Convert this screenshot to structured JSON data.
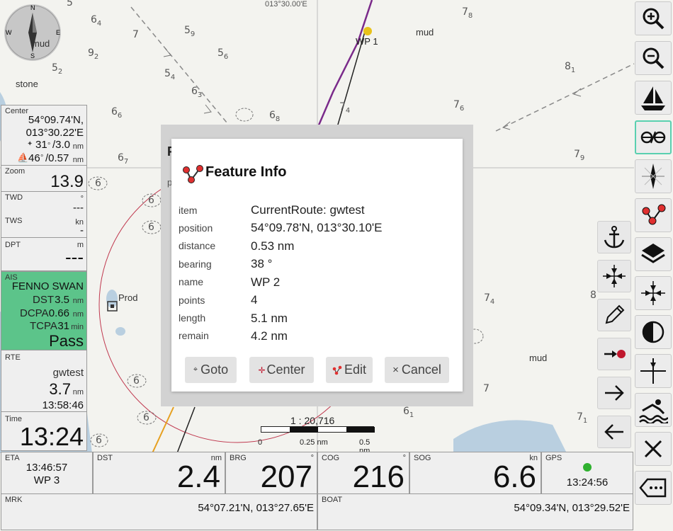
{
  "map": {
    "top_coordinate": "013°30.00'E",
    "labels": {
      "mud1": "mud",
      "mud2": "mud",
      "mud3": "mud",
      "stone": "stone",
      "prod": "Prod",
      "wp1": "WP 1"
    },
    "depths": [
      [
        "6",
        "4"
      ],
      [
        "7",
        ""
      ],
      [
        "5",
        "9"
      ],
      [
        "9",
        "2"
      ],
      [
        "5",
        "6"
      ],
      [
        "5",
        "2"
      ],
      [
        "5",
        "4"
      ],
      [
        "7",
        "8"
      ],
      [
        "8",
        "1"
      ],
      [
        "6",
        "3"
      ],
      [
        "6",
        "6"
      ],
      [
        "7",
        "4"
      ],
      [
        "7",
        "6"
      ],
      [
        "6",
        "8"
      ],
      [
        "6",
        "7"
      ],
      [
        "7",
        "9"
      ],
      [
        "6",
        ""
      ],
      [
        "6",
        ""
      ],
      [
        "6",
        ""
      ],
      [
        "7",
        "4"
      ],
      [
        "8",
        ""
      ],
      [
        "7",
        ""
      ],
      [
        "7",
        "1"
      ],
      [
        "6",
        "1"
      ],
      [
        "6",
        ""
      ],
      [
        "6",
        ""
      ],
      [
        "5",
        ""
      ]
    ],
    "scale": {
      "ratio": "1 : 20,716",
      "t0": "0",
      "t1": "0.25 nm",
      "t2": "0.5 nm"
    },
    "compass": {
      "n": "N",
      "e": "E",
      "s": "S",
      "w": "W"
    }
  },
  "left": {
    "center": {
      "label": "Center",
      "lat": "54°09.74'N,",
      "lon": "013°30.22'E",
      "bearing": "31",
      "bearing_unit": "°",
      "dist": "/3.0",
      "dist_unit": "nm",
      "boat_brg": "46",
      "boat_dist": "/0.57",
      "boat_unit": "nm"
    },
    "zoom": {
      "label": "Zoom",
      "value": "13.9"
    },
    "twd": {
      "label": "TWD",
      "unit": "°",
      "value": "---"
    },
    "tws": {
      "label": "TWS",
      "unit": "kn",
      "value": "-"
    },
    "dpt": {
      "label": "DPT",
      "unit": "m",
      "value": "---"
    },
    "ais": {
      "label": "AIS",
      "name": "FENNO SWAN",
      "dst_label": "DST",
      "dst": "3.5",
      "dst_unit": "nm",
      "dcpa_label": "DCPA",
      "dcpa": "0.66",
      "dcpa_unit": "nm",
      "tcpa_label": "TCPA",
      "tcpa": "31",
      "tcpa_unit": "min",
      "status": "Pass",
      "color": "#5cc48a"
    },
    "rte": {
      "label": "RTE",
      "name": "gwtest",
      "dist": "3.7",
      "dist_unit": "nm",
      "time": "13:58:46"
    },
    "time": {
      "label": "Time",
      "value": "13:24"
    }
  },
  "bottom": {
    "eta": {
      "label": "ETA",
      "time": "13:46:57",
      "wp": "WP 3"
    },
    "dst": {
      "label": "DST",
      "unit": "nm",
      "value": "2.4"
    },
    "brg": {
      "label": "BRG",
      "unit": "°",
      "value": "207"
    },
    "cog": {
      "label": "COG",
      "unit": "°",
      "value": "216"
    },
    "sog": {
      "label": "SOG",
      "unit": "kn",
      "value": "6.6"
    },
    "gps": {
      "label": "GPS",
      "time": "13:24:56",
      "status_color": "#2fb12f"
    },
    "mrk": {
      "label": "MRK",
      "value": "54°07.21'N, 013°27.65'E"
    },
    "boat": {
      "label": "BOAT",
      "value": "54°09.34'N, 013°29.52'E"
    }
  },
  "dialog": {
    "title": "Feature Info",
    "rows": [
      {
        "k": "item",
        "v": "CurrentRoute: gwtest"
      },
      {
        "k": "position",
        "v": "54°09.78'N, 013°30.10'E"
      },
      {
        "k": "distance",
        "v": "0.53 nm"
      },
      {
        "k": "bearing",
        "v": "38 °"
      },
      {
        "k": "name",
        "v": "WP 2"
      },
      {
        "k": "points",
        "v": "4"
      },
      {
        "k": "length",
        "v": "5.1 nm"
      },
      {
        "k": "remain",
        "v": "4.2 nm"
      }
    ],
    "buttons": {
      "goto": "Goto",
      "center": "Center",
      "edit": "Edit",
      "cancel": "Cancel"
    },
    "overlay_letter1": "F",
    "overlay_letter2": "p"
  },
  "colors": {
    "active_border": "#5ad0b0",
    "route": "#7a2a8a",
    "dlg_icon": "#e03030"
  }
}
